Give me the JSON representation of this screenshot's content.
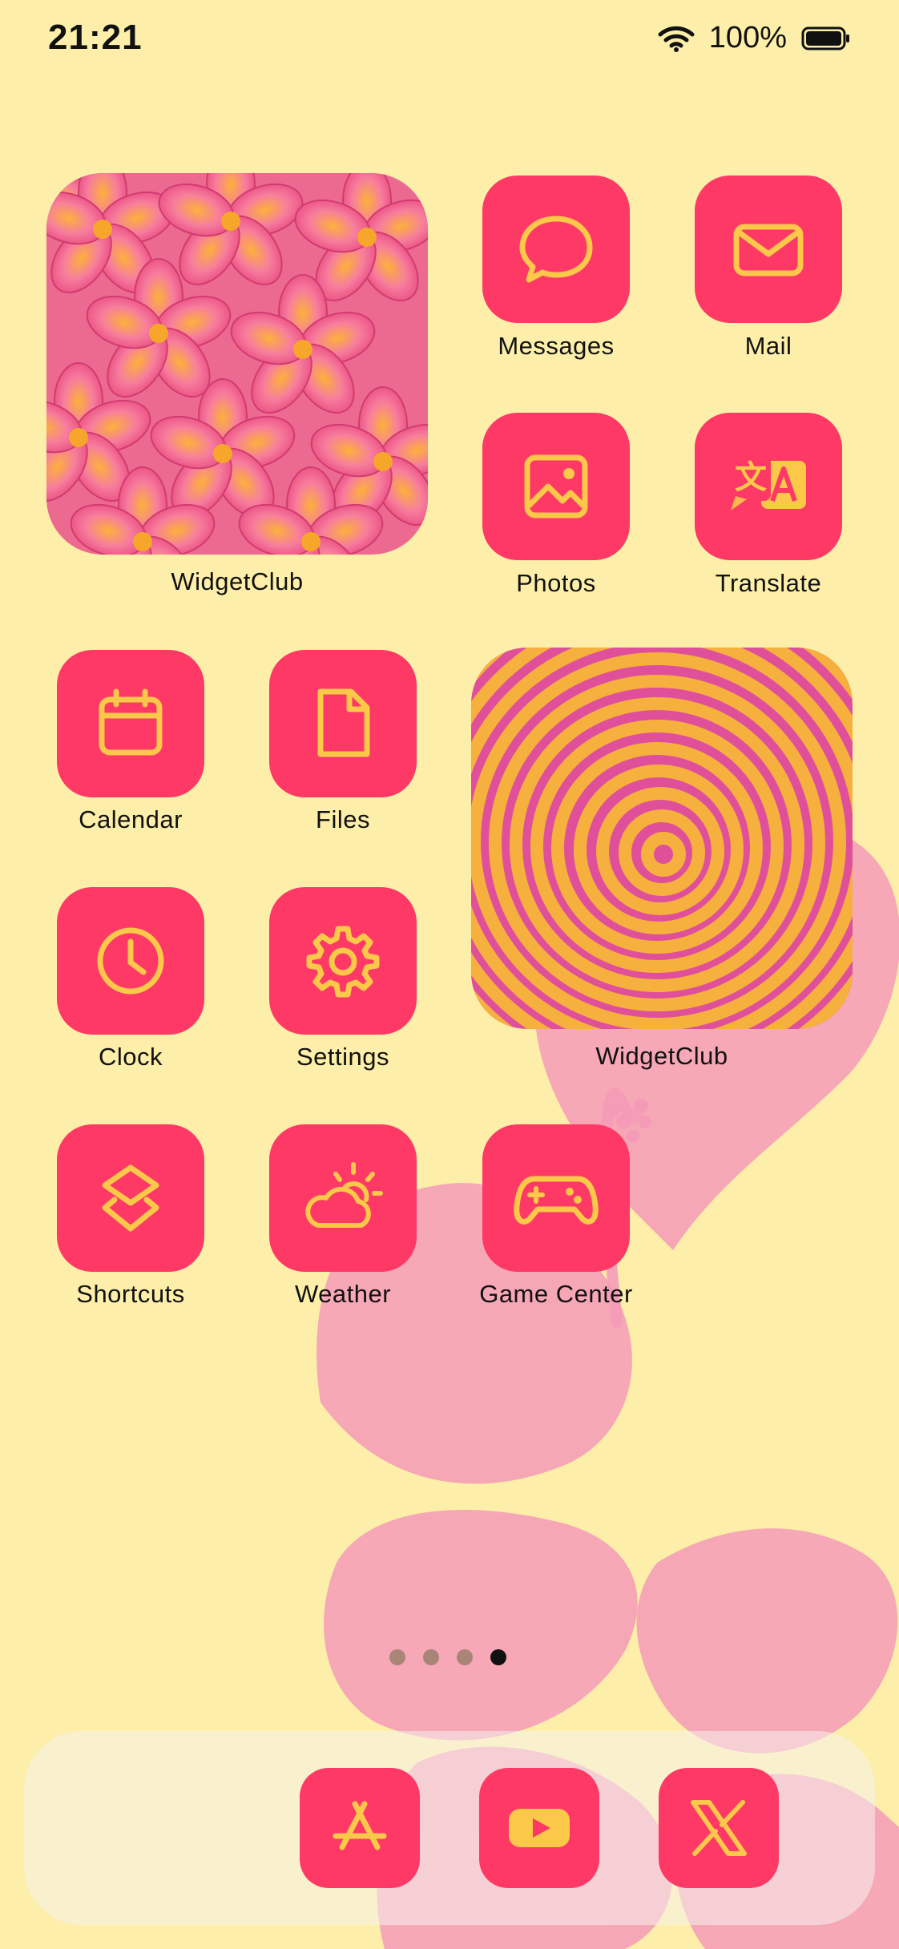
{
  "status_bar": {
    "time": "21:21",
    "battery_percent": "100%",
    "icons": [
      "wifi-icon",
      "battery-icon"
    ]
  },
  "colors": {
    "background": "#fdefa9",
    "tile": "#fe3966",
    "glyph": "#fbc84a",
    "hibiscus": "#f59bb8"
  },
  "apps": {
    "widget1": "WidgetClub",
    "messages": "Messages",
    "mail": "Mail",
    "photos": "Photos",
    "translate": "Translate",
    "calendar": "Calendar",
    "files": "Files",
    "widget2": "WidgetClub",
    "clock": "Clock",
    "settings": "Settings",
    "shortcuts": "Shortcuts",
    "weather": "Weather",
    "game_center": "Game Center"
  },
  "page_indicator": {
    "pages": 4,
    "current": 4
  },
  "dock": {
    "apps": [
      "app-store-icon",
      "youtube-icon",
      "x-icon"
    ]
  }
}
